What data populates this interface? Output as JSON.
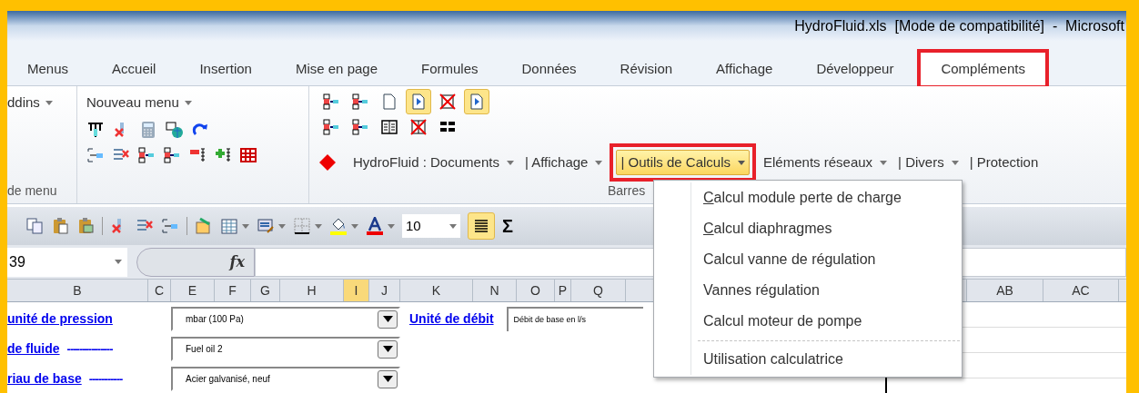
{
  "window": {
    "title": "HydroFluid.xls  [Mode de compatibilité]  -  Microsoft"
  },
  "tabs": [
    {
      "label": "Menus",
      "selected": false,
      "highlighted": false
    },
    {
      "label": "Accueil",
      "selected": false,
      "highlighted": false
    },
    {
      "label": "Insertion",
      "selected": false,
      "highlighted": false
    },
    {
      "label": "Mise en page",
      "selected": false,
      "highlighted": false
    },
    {
      "label": "Formules",
      "selected": false,
      "highlighted": false
    },
    {
      "label": "Données",
      "selected": false,
      "highlighted": false
    },
    {
      "label": "Révision",
      "selected": false,
      "highlighted": false
    },
    {
      "label": "Affichage",
      "selected": false,
      "highlighted": false
    },
    {
      "label": "Développeur",
      "selected": false,
      "highlighted": false
    },
    {
      "label": "Compléments",
      "selected": true,
      "highlighted": true
    }
  ],
  "ribbon": {
    "addins": {
      "label": "ddins",
      "group_label": "de menu"
    },
    "custom_menu": {
      "label": "Nouveau menu"
    },
    "bars": {
      "group_label": "Barres",
      "icon_buttons": [
        {
          "pressed": false
        },
        {
          "pressed": false
        },
        {
          "pressed": false
        },
        {
          "pressed": true
        },
        {
          "pressed": false
        },
        {
          "pressed": true
        }
      ],
      "menus": [
        {
          "label": "HydroFluid : Documents",
          "caret": true,
          "open": false,
          "highlighted": false
        },
        {
          "label": "| Affichage",
          "caret": true,
          "open": false,
          "highlighted": false
        },
        {
          "label": "| Outils de Calculs",
          "caret": true,
          "open": true,
          "highlighted": true
        },
        {
          "label": "Eléments réseaux",
          "caret": true,
          "open": false,
          "highlighted": false
        },
        {
          "label": "| Divers",
          "caret": true,
          "open": false,
          "highlighted": false
        },
        {
          "label": "| Protection",
          "caret": false,
          "open": false,
          "highlighted": false
        }
      ]
    }
  },
  "toolbar": {
    "font_size": "10",
    "align_pressed": true,
    "sum": "Σ"
  },
  "formula_bar": {
    "name_box": "39",
    "fx": "fx"
  },
  "sheet": {
    "columns": [
      {
        "label": "B",
        "selected": false
      },
      {
        "label": "C",
        "selected": false
      },
      {
        "label": "E",
        "selected": false
      },
      {
        "label": "F",
        "selected": false
      },
      {
        "label": "G",
        "selected": false
      },
      {
        "label": "H",
        "selected": false
      },
      {
        "label": "I",
        "selected": true
      },
      {
        "label": "J",
        "selected": false
      },
      {
        "label": "K",
        "selected": false
      },
      {
        "label": "N",
        "selected": false
      },
      {
        "label": "O",
        "selected": false
      },
      {
        "label": "P",
        "selected": false
      },
      {
        "label": "Q",
        "selected": false
      },
      {
        "label": "AB",
        "selected": false
      },
      {
        "label": "AC",
        "selected": false
      }
    ],
    "rows": [
      {
        "label": "unité de pression",
        "combo": "mbar (100 Pa)",
        "label2": "Unité de débit",
        "value2": "Débit de base en l/s"
      },
      {
        "label": "de fluide",
        "dashes": "---------------",
        "combo": "Fuel oil 2"
      },
      {
        "label": "riau de base",
        "dashes": "-----------",
        "combo": "Acier galvanisé, neuf"
      }
    ]
  },
  "menu": {
    "items": [
      {
        "label": "Calcul module perte de charge",
        "accelerator": true,
        "separator_before": false
      },
      {
        "label": "Calcul diaphragmes",
        "accelerator": true,
        "separator_before": false
      },
      {
        "label": "Calcul vanne de régulation",
        "accelerator": false,
        "separator_before": false
      },
      {
        "label": "Vannes régulation",
        "accelerator": false,
        "separator_before": false
      },
      {
        "label": "Calcul moteur de pompe",
        "accelerator": false,
        "separator_before": false
      },
      {
        "label": "Utilisation calculatrice",
        "accelerator": false,
        "separator_before": true
      }
    ]
  }
}
